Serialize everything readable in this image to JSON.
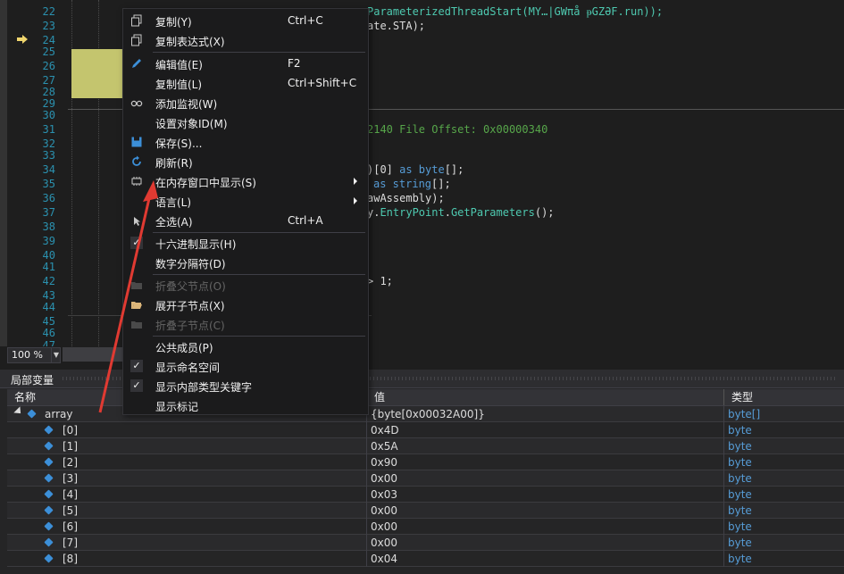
{
  "editor": {
    "line_numbers": [
      "22",
      "23",
      "24",
      "25",
      "26",
      "27",
      "28",
      "29",
      "30",
      "31",
      "32",
      "33",
      "34",
      "35",
      "36",
      "37",
      "38",
      "39",
      "40",
      "41",
      "42",
      "43",
      "44",
      "45",
      "46",
      "47"
    ],
    "code_line_22": "ParameterizedThreadStart(MY…|GWπå ᵽGZƏF.run));",
    "code_line_23": "ate.STA);",
    "code_line_31_comment": "2140 File Offset: 0x00000340",
    "code_line_34a": ")[0] ",
    "code_line_34b": "as",
    "code_line_34c": " byte",
    "code_line_34d": "[];",
    "code_line_35a": "as",
    "code_line_35b": " string",
    "code_line_35c": "[];",
    "code_line_36": "awAssembly);",
    "code_line_37a": "y.",
    "code_line_37b": "EntryPoint",
    "code_line_37c": ".",
    "code_line_37d": "GetParameters",
    "code_line_37e": "();",
    "code_line_42": "> 1;"
  },
  "zoom": {
    "value": "100 %"
  },
  "locals": {
    "title": "局部变量",
    "columns": {
      "name": "名称",
      "value": "值",
      "type": "类型"
    },
    "rows": [
      {
        "name": "array",
        "value": "{byte[0x00032A00]}",
        "type": "byte[]"
      },
      {
        "name": "[0]",
        "value": "0x4D",
        "type": "byte"
      },
      {
        "name": "[1]",
        "value": "0x5A",
        "type": "byte"
      },
      {
        "name": "[2]",
        "value": "0x90",
        "type": "byte"
      },
      {
        "name": "[3]",
        "value": "0x00",
        "type": "byte"
      },
      {
        "name": "[4]",
        "value": "0x03",
        "type": "byte"
      },
      {
        "name": "[5]",
        "value": "0x00",
        "type": "byte"
      },
      {
        "name": "[6]",
        "value": "0x00",
        "type": "byte"
      },
      {
        "name": "[7]",
        "value": "0x00",
        "type": "byte"
      },
      {
        "name": "[8]",
        "value": "0x04",
        "type": "byte"
      }
    ]
  },
  "menu": {
    "copy": "复制(Y)",
    "copy_sc": "Ctrl+C",
    "copy_expr": "复制表达式(X)",
    "edit_value": "编辑值(E)",
    "edit_value_sc": "F2",
    "copy_value": "复制值(L)",
    "copy_value_sc": "Ctrl+Shift+C",
    "add_watch": "添加监视(W)",
    "set_object_id": "设置对象ID(M)",
    "save": "保存(S)...",
    "refresh": "刷新(R)",
    "show_in_memory": "在内存窗口中显示(S)",
    "language": "语言(L)",
    "select_all": "全选(A)",
    "select_all_sc": "Ctrl+A",
    "hex_display": "十六进制显示(H)",
    "digit_separators": "数字分隔符(D)",
    "collapse_parent": "折叠父节点(O)",
    "expand_children": "展开子节点(X)",
    "collapse_children": "折叠子节点(C)",
    "public_members": "公共成员(P)",
    "show_namespaces": "显示命名空间",
    "show_intrinsic_keywords": "显示内部类型关键字",
    "show_tokens": "显示标记"
  },
  "colors": {
    "annotation_arrow": "#e03a32",
    "highlight_block": "#c4c56e",
    "type_blue": "#569cd6"
  }
}
